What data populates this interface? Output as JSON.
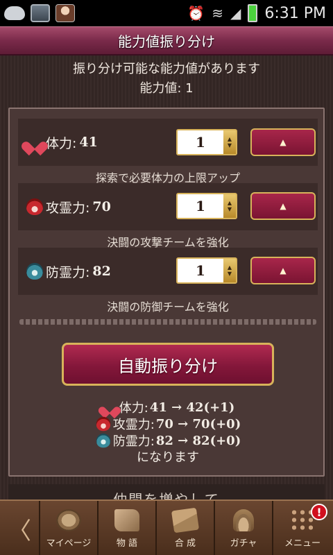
{
  "status_bar": {
    "time": "6:31 PM"
  },
  "title": "能力値振り分け",
  "intro": {
    "line1": "振り分け可能な能力値があります",
    "line2": "能力値: 1"
  },
  "stats": [
    {
      "label": "体力:",
      "value": "41",
      "stepper": "1",
      "up": "▲",
      "desc": "探索で必要体力の上限アップ",
      "icon": "heart-icon"
    },
    {
      "label": "攻霊力:",
      "value": "70",
      "stepper": "1",
      "up": "▲",
      "desc": "決闘の攻撃チームを強化",
      "icon": "flame-icon"
    },
    {
      "label": "防霊力:",
      "value": "82",
      "stepper": "1",
      "up": "▲",
      "desc": "決闘の防御チームを強化",
      "icon": "shield-icon"
    }
  ],
  "auto_button": "自動振り分け",
  "preview": {
    "lines": [
      {
        "label": "体力:",
        "text": "41 → 42(+1)"
      },
      {
        "label": "攻霊力:",
        "text": "70 → 70(+0)"
      },
      {
        "label": "防霊力:",
        "text": "82 → 82(+0)"
      }
    ],
    "end": "になります"
  },
  "banner_peek": "仲間を増やして",
  "nav": {
    "back": "〈",
    "items": [
      {
        "label": "マイページ",
        "icon": "mypage-icon"
      },
      {
        "label": "物 語",
        "icon": "story-icon"
      },
      {
        "label": "合 成",
        "icon": "compose-icon"
      },
      {
        "label": "ガチャ",
        "icon": "gacha-icon"
      },
      {
        "label": "メニュー",
        "icon": "menu-icon"
      }
    ],
    "badge": "!"
  }
}
